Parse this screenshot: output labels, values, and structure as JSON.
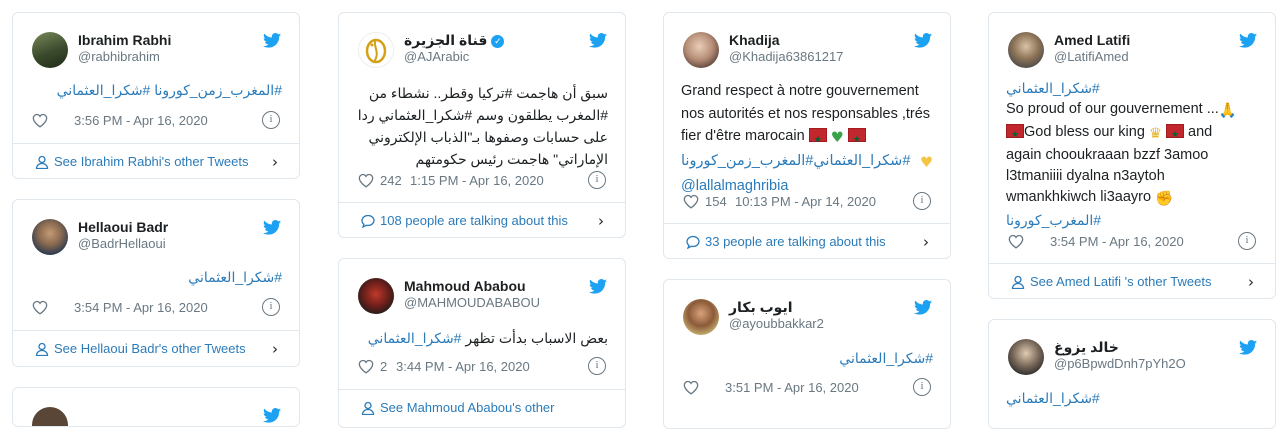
{
  "tweets": {
    "rabhi": {
      "name": "Ibrahim Rabhi",
      "handle": "@rabhibrahim",
      "text": "#المغرب_زمن_كورونا #شكرا_العثماني",
      "time": "3:56 PM - Apr 16, 2020",
      "footer": "See Ibrahim Rabhi's other Tweets"
    },
    "hellaoui": {
      "name": "Hellaoui Badr",
      "handle": "@BadrHellaoui",
      "text": "#شكرا_العثماني",
      "time": "3:54 PM - Apr 16, 2020",
      "footer": "See Hellaoui Badr's other Tweets"
    },
    "jazeera": {
      "name": "قناة الجزيرة",
      "handle": "@AJArabic",
      "text": "سبق أن هاجمت #تركيا وقطر.. نشطاء من #المغرب يطلقون وسم #شكرا_العثماني ردا على حسابات وصفوها بـ\"الذباب الإلكتروني الإماراتي\" هاجمت رئيس حكومتهم",
      "likes": "242",
      "time": "1:15 PM - Apr 16, 2020",
      "footer": "108 people are talking about this"
    },
    "ababou": {
      "name": "Mahmoud Ababou",
      "handle": "@MAHMOUDABABOU",
      "text_plain": "بعض الاسباب بدأت تظهر ",
      "text_tag": "#شكرا_العثماني",
      "likes": "2",
      "time": "3:44 PM - Apr 16, 2020",
      "footer": "See Mahmoud Ababou's other"
    },
    "khadija": {
      "name": "Khadija",
      "handle": "@Khadija63861217",
      "line1": "Grand respect à notre gouvernement",
      "line2": "nos autorités et nos responsables ,trés",
      "line3": "fier d'être marocain",
      "tags": "#شكرا_العثماني#المغرب_زمن_كورونا",
      "mention": "@lallalmaghribia",
      "likes": "154",
      "time": "10:13 PM - Apr 14, 2020",
      "footer": "33 people are talking about this"
    },
    "bakkar": {
      "name": "ايوب بكار",
      "handle": "@ayoubbakkar2",
      "text": "#شكرا_العثماني",
      "time": "3:51 PM - Apr 16, 2020"
    },
    "latifi": {
      "name": "Amed Latifi",
      "handle": "@LatifiAmed",
      "tag1": "#شكرا_العثماني",
      "line1": "So proud of our gouvernement ...",
      "line2a": "God bless our king",
      "line2b": "and",
      "line3": "again chooukraaan bzzf 3amoo",
      "line4": "l3tmaniiii dyalna n3aytoh",
      "line5": "wmankhkiwch li3aayro",
      "tag2": "#المغرب_كورونا",
      "time": "3:54 PM - Apr 16, 2020",
      "footer": "See Amed Latifi 's other Tweets"
    },
    "yazough": {
      "name": "خالد يزوغ",
      "handle": "@p6BpwdDnh7pYh2O",
      "text": "#شكرا_العثماني"
    }
  },
  "colors": {
    "link": "#2b7bb9",
    "twitter_blue": "#1da1f2",
    "muted": "#697882",
    "border": "#e1e8ed"
  },
  "icons": [
    "twitter-bird-icon",
    "heart-icon",
    "info-icon",
    "person-icon",
    "speech-bubble-icon",
    "chevron-right-icon",
    "verified-badge-icon",
    "morocco-flag-emoji",
    "green-heart-emoji",
    "yellow-heart-emoji",
    "praying-hands-emoji",
    "crown-emoji",
    "fist-emoji"
  ]
}
